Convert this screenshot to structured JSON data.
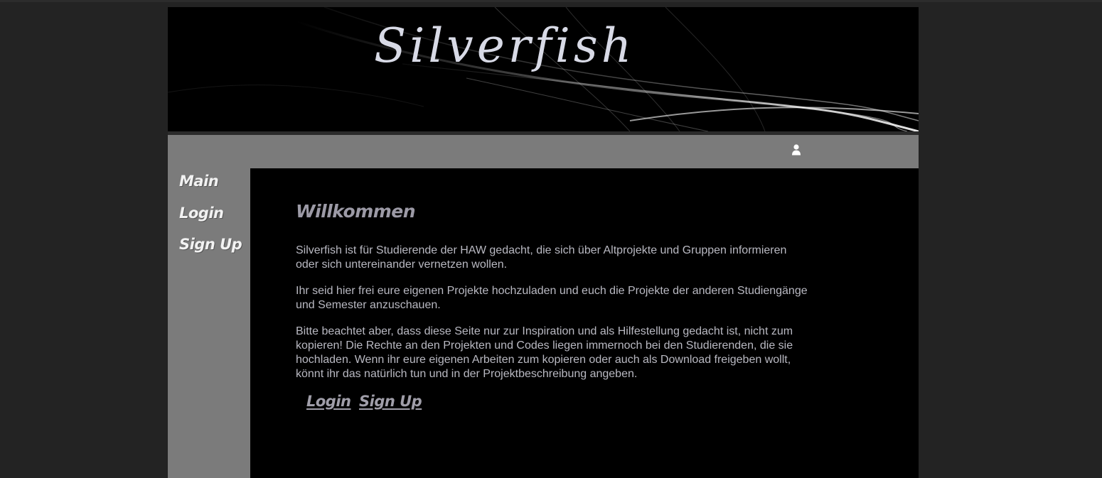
{
  "header": {
    "title": "Silverfish"
  },
  "topbar": {
    "user_icon": "user-icon"
  },
  "sidebar": {
    "items": [
      {
        "label": "Main"
      },
      {
        "label": "Login"
      },
      {
        "label": "Sign Up"
      }
    ]
  },
  "main": {
    "heading": "Willkommen",
    "paragraphs": [
      "Silverfish ist für Studierende der HAW gedacht, die sich über Altprojekte und Gruppen informieren oder sich untereinander vernetzen wollen.",
      "Ihr seid hier frei eure eigenen Projekte hochzuladen und euch die Projekte der anderen Studiengänge und Semester anzuschauen.",
      "Bitte beachtet aber, dass diese Seite nur zur Inspiration und als Hilfestellung gedacht ist, nicht zum kopieren! Die Rechte an den Projekten und Codes liegen immernoch bei den Studierenden, die sie hochladen. Wenn ihr eure eigenen Arbeiten zum kopieren oder auch als Download freigeben wollt, könnt ihr das natürlich tun und in der Projektbeschreibung angeben."
    ],
    "actions": {
      "login_label": "Login",
      "signup_label": "Sign Up"
    }
  },
  "colors": {
    "page_background": "#232323",
    "banner_background": "#000000",
    "nav_background": "#7b7b7b",
    "content_background": "#000000",
    "body_text": "#b9b9c2",
    "heading_text": "#9c9aa6"
  }
}
